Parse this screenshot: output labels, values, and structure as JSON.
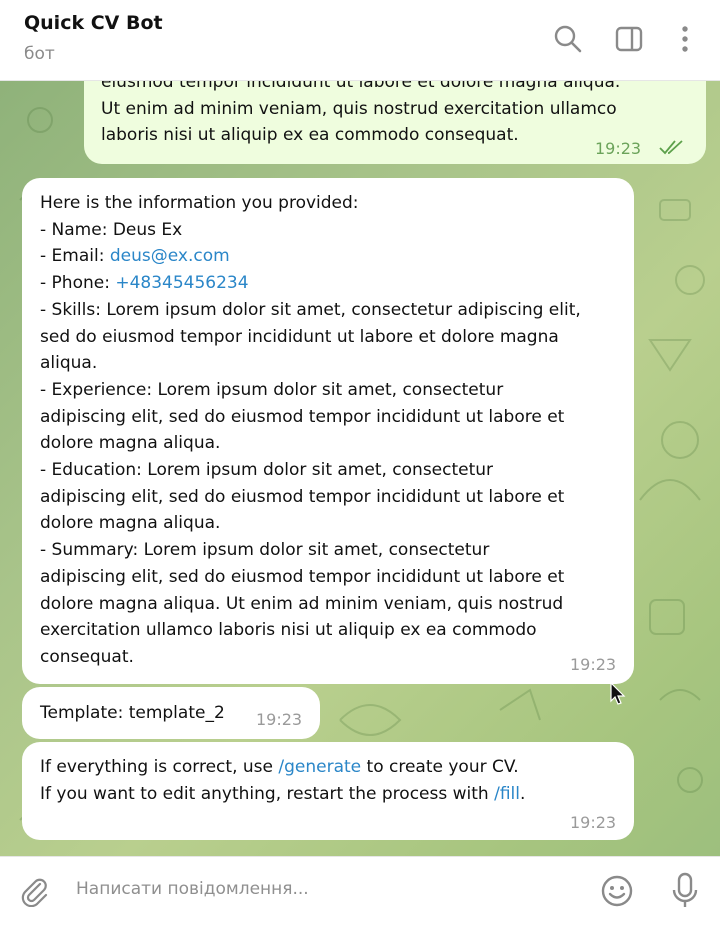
{
  "header": {
    "title": "Quick CV Bot",
    "subtitle": "бот"
  },
  "messages": {
    "outgoing": {
      "lines": [
        "eiusmod tempor incididunt ut labore et dolore magna aliqua.",
        "Ut enim ad minim veniam, quis nostrud exercitation ullamco",
        "laboris nisi ut aliquip ex ea commodo consequat."
      ],
      "time": "19:23",
      "status": "read"
    },
    "info": {
      "intro": "Here is the information you provided:",
      "name": "- Name: Deus Ex",
      "email_prefix": "- Email: ",
      "email": "deus@ex.com",
      "phone_prefix": "- Phone: ",
      "phone": "+48345456234",
      "lines": [
        "- Skills: Lorem ipsum dolor sit amet, consectetur adipiscing elit,",
        "sed do eiusmod tempor incididunt ut labore et dolore magna",
        "aliqua.",
        "- Experience: Lorem ipsum dolor sit amet, consectetur",
        "adipiscing elit, sed do eiusmod tempor incididunt ut labore et",
        "dolore magna aliqua.",
        "- Education: Lorem ipsum dolor sit amet, consectetur",
        "adipiscing elit, sed do eiusmod tempor incididunt ut labore et",
        "dolore magna aliqua.",
        "- Summary: Lorem ipsum dolor sit amet, consectetur",
        "adipiscing elit, sed do eiusmod tempor incididunt ut labore et",
        "dolore magna aliqua. Ut enim ad minim veniam, quis nostrud",
        "exercitation ullamco laboris nisi ut aliquip ex ea commodo",
        "consequat."
      ],
      "time": "19:23"
    },
    "template": {
      "text": "Template: template_2",
      "time": "19:23"
    },
    "final": {
      "line1_pre": "If everything is correct, use ",
      "line1_cmd": "/generate",
      "line1_post": " to create your CV.",
      "line2_pre": "If you want to edit anything, restart the process with ",
      "line2_cmd": "/fill",
      "line2_post": ".",
      "time": "19:23"
    }
  },
  "composer": {
    "placeholder": "Написати повідомлення..."
  },
  "icons": [
    "search-icon",
    "sidebar-panel-icon",
    "more-vertical-icon",
    "paperclip-icon",
    "emoji-icon",
    "microphone-icon",
    "double-check-icon",
    "mouse-cursor-icon"
  ],
  "colors": {
    "link": "#2a86c8",
    "outgoing_bubble": "#effdde",
    "chat_background": "#a9c48a"
  }
}
